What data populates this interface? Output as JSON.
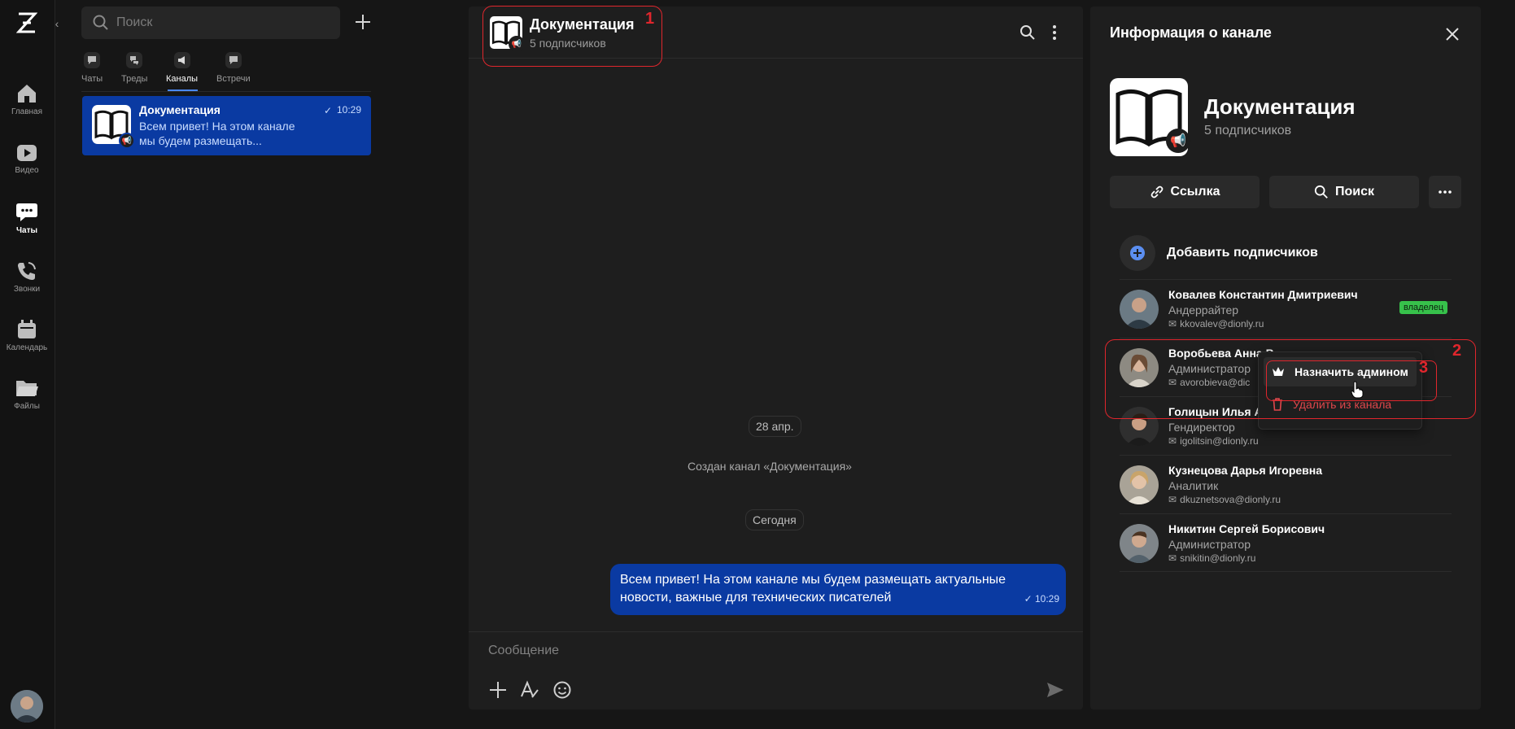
{
  "rail": {
    "nav": [
      {
        "label": "Главная",
        "icon": "home-icon"
      },
      {
        "label": "Видео",
        "icon": "video-icon"
      },
      {
        "label": "Чаты",
        "icon": "chat-icon",
        "active": true
      },
      {
        "label": "Звонки",
        "icon": "phone-icon"
      },
      {
        "label": "Календарь",
        "icon": "calendar-icon"
      },
      {
        "label": "Файлы",
        "icon": "folder-icon"
      }
    ]
  },
  "list": {
    "search_placeholder": "Поиск",
    "tabs": [
      {
        "label": "Чаты"
      },
      {
        "label": "Треды"
      },
      {
        "label": "Каналы",
        "active": true
      },
      {
        "label": "Встречи"
      }
    ],
    "items": [
      {
        "name": "Документация",
        "preview": "Всем привет! На этом канале мы будем размещать...",
        "time": "10:29"
      }
    ]
  },
  "chat": {
    "title": "Документация",
    "subtitle": "5 подписчиков",
    "date_pill_1": "28 апр.",
    "system_msg": "Создан канал «Документация»",
    "date_pill_2": "Сегодня",
    "message": {
      "text": "Всем привет! На этом канале мы будем размещать актуальные новости, важные для технических писателей",
      "time": "10:29"
    },
    "composer_placeholder": "Сообщение"
  },
  "annotations": {
    "n1": "1",
    "n2": "2",
    "n3": "3"
  },
  "info": {
    "title": "Информация о канале",
    "name": "Документация",
    "subtitle": "5 подписчиков",
    "btn_link": "Ссылка",
    "btn_search": "Поиск",
    "add_subscribers": "Добавить подписчиков",
    "owner_badge": "владелец",
    "members": [
      {
        "name": "Ковалев Константин Дмитриевич",
        "role": "Андеррайтер",
        "email": "kkovalev@dionly.ru"
      },
      {
        "name": "Воробьева Анна В",
        "role": "Администратор",
        "email": "avorobieva@dic"
      },
      {
        "name": "Голицын Илья А",
        "role": "Гендиректор",
        "email": "igolitsin@dionly.ru"
      },
      {
        "name": "Кузнецова Дарья Игоревна",
        "role": "Аналитик",
        "email": "dkuznetsova@dionly.ru"
      },
      {
        "name": "Никитин Сергей Борисович",
        "role": "Администратор",
        "email": "snikitin@dionly.ru"
      }
    ],
    "context_menu": {
      "make_admin": "Назначить админом",
      "remove": "Удалить из канала"
    }
  },
  "colors": {
    "accent": "#0a3aa2",
    "annotation": "#e0262d",
    "owner_badge": "#37c14b"
  }
}
